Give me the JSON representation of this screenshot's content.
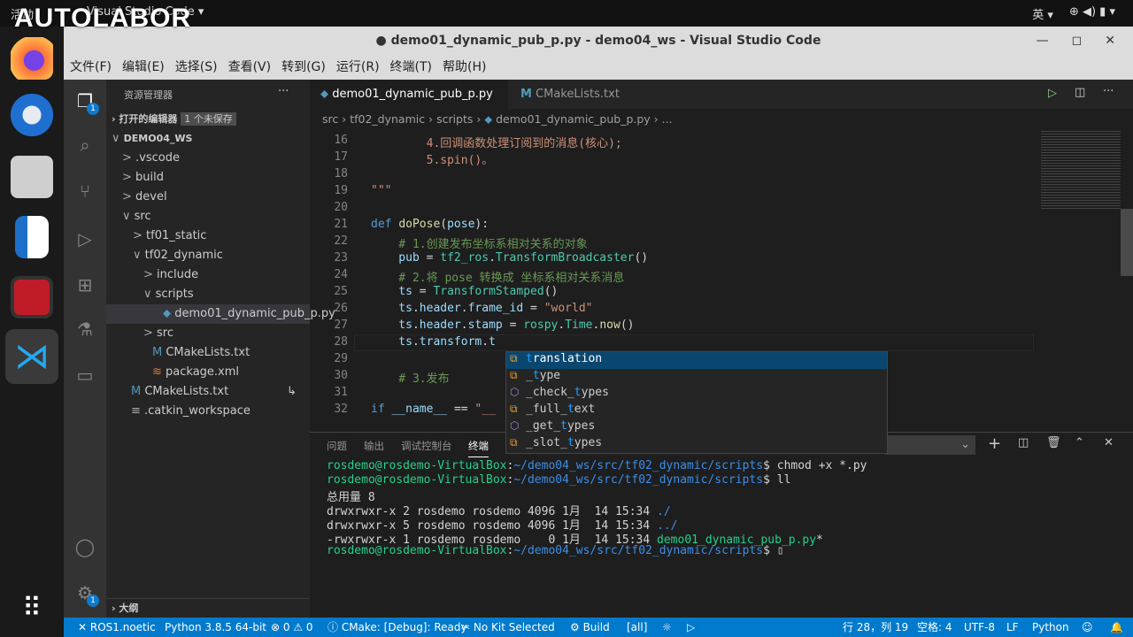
{
  "topbar": {
    "activities": "活动",
    "app": "Visual Studio Code ▾",
    "logo": "AUTOLABOR",
    "ime": "英 ▾",
    "tray": "⊕ ◀) ▮ ▾"
  },
  "window": {
    "title": "● demo01_dynamic_pub_p.py - demo04_ws - Visual Studio Code",
    "controls": [
      "—",
      "◻",
      "✕"
    ]
  },
  "menu": [
    "文件(F)",
    "编辑(E)",
    "选择(S)",
    "查看(V)",
    "转到(G)",
    "运行(R)",
    "终端(T)",
    "帮助(H)"
  ],
  "activity": {
    "explorer_badge": "1",
    "settings_badge": "1"
  },
  "sidebar": {
    "title": "资源管理器",
    "more": "···",
    "open_editors": "打开的编辑器",
    "unsaved": "1 个未保存",
    "outline": "大纲",
    "tree": [
      {
        "label": "DEMO04_WS",
        "indent": 0,
        "arrow": "∨",
        "bold": true
      },
      {
        "label": ".vscode",
        "indent": 1,
        "arrow": ">"
      },
      {
        "label": "build",
        "indent": 1,
        "arrow": ">"
      },
      {
        "label": "devel",
        "indent": 1,
        "arrow": ">"
      },
      {
        "label": "src",
        "indent": 1,
        "arrow": "∨"
      },
      {
        "label": "tf01_static",
        "indent": 2,
        "arrow": ">"
      },
      {
        "label": "tf02_dynamic",
        "indent": 2,
        "arrow": "∨"
      },
      {
        "label": "include",
        "indent": 3,
        "arrow": ">"
      },
      {
        "label": "scripts",
        "indent": 3,
        "arrow": "∨"
      },
      {
        "label": "demo01_dynamic_pub_p.py",
        "indent": 4,
        "icon": "python",
        "selected": true
      },
      {
        "label": "src",
        "indent": 3,
        "arrow": ">"
      },
      {
        "label": "CMakeLists.txt",
        "indent": 3,
        "icon": "cmake"
      },
      {
        "label": "package.xml",
        "indent": 3,
        "icon": "xml"
      },
      {
        "label": "CMakeLists.txt",
        "indent": 1,
        "icon": "cmake",
        "link": "↳"
      },
      {
        "label": ".catkin_workspace",
        "indent": 1,
        "icon": "file"
      }
    ]
  },
  "tabs": [
    {
      "label": "demo01_dynamic_pub_p.py",
      "dirty": "●",
      "active": true
    },
    {
      "label": "CMakeLists.txt",
      "icon": "M"
    }
  ],
  "breadcrumb": [
    "src",
    "tf02_dynamic",
    "scripts",
    "demo01_dynamic_pub_p.py",
    "..."
  ],
  "code": [
    {
      "n": "16",
      "tokens": [
        [
          "        4.回调函数处理订阅到的消息(核心);",
          "y"
        ]
      ]
    },
    {
      "n": "17",
      "tokens": [
        [
          "        5.spin()。",
          "y"
        ]
      ]
    },
    {
      "n": "18",
      "tokens": []
    },
    {
      "n": "19",
      "tokens": [
        [
          "\"\"\"",
          "y"
        ]
      ]
    },
    {
      "n": "20",
      "tokens": []
    },
    {
      "n": "21",
      "tokens": [
        [
          "def ",
          "k"
        ],
        [
          "doPose",
          "f"
        ],
        [
          "(",
          "d"
        ],
        [
          "pose",
          "p"
        ],
        [
          "):",
          "d"
        ]
      ]
    },
    {
      "n": "22",
      "tokens": [
        [
          "    # 1.创建发布坐标系相对关系的对象",
          "c"
        ]
      ]
    },
    {
      "n": "23",
      "tokens": [
        [
          "    pub ",
          "p"
        ],
        [
          "= ",
          "d"
        ],
        [
          "tf2_ros",
          "t"
        ],
        [
          ".",
          "d"
        ],
        [
          "TransformBroadcaster",
          "t"
        ],
        [
          "()",
          "d"
        ]
      ]
    },
    {
      "n": "24",
      "tokens": [
        [
          "    # 2.将 pose 转换成 坐标系相对关系消息",
          "c"
        ]
      ]
    },
    {
      "n": "25",
      "tokens": [
        [
          "    ts ",
          "p"
        ],
        [
          "= ",
          "d"
        ],
        [
          "TransformStamped",
          "t"
        ],
        [
          "()",
          "d"
        ]
      ]
    },
    {
      "n": "26",
      "tokens": [
        [
          "    ts",
          "p"
        ],
        [
          ".",
          "d"
        ],
        [
          "header",
          "p"
        ],
        [
          ".",
          "d"
        ],
        [
          "frame_id ",
          "p"
        ],
        [
          "= ",
          "d"
        ],
        [
          "\"world\"",
          "s"
        ]
      ]
    },
    {
      "n": "27",
      "tokens": [
        [
          "    ts",
          "p"
        ],
        [
          ".",
          "d"
        ],
        [
          "header",
          "p"
        ],
        [
          ".",
          "d"
        ],
        [
          "stamp ",
          "p"
        ],
        [
          "= ",
          "d"
        ],
        [
          "rospy",
          "t"
        ],
        [
          ".",
          "d"
        ],
        [
          "Time",
          "t"
        ],
        [
          ".",
          "d"
        ],
        [
          "now",
          "f"
        ],
        [
          "()",
          "d"
        ]
      ]
    },
    {
      "n": "28",
      "tokens": [
        [
          "    ts",
          "p"
        ],
        [
          ".",
          "d"
        ],
        [
          "transform",
          "p"
        ],
        [
          ".",
          "d"
        ],
        [
          "t",
          "p"
        ]
      ]
    },
    {
      "n": "29",
      "tokens": []
    },
    {
      "n": "30",
      "tokens": [
        [
          "    # 3.发布",
          "c"
        ]
      ]
    },
    {
      "n": "31",
      "tokens": []
    },
    {
      "n": "32",
      "tokens": [
        [
          "if ",
          "k"
        ],
        [
          "__name__ ",
          "p"
        ],
        [
          "== ",
          "d"
        ],
        [
          "\"__",
          "s"
        ]
      ]
    }
  ],
  "suggestions": [
    {
      "pre": "",
      "hl": "t",
      "post": "ranslation",
      "icon": "field"
    },
    {
      "pre": "_",
      "hl": "t",
      "post": "ype",
      "icon": "field"
    },
    {
      "pre": "_check_",
      "hl": "t",
      "post": "ypes",
      "icon": "method"
    },
    {
      "pre": "_full_",
      "hl": "t",
      "post": "ext",
      "icon": "field"
    },
    {
      "pre": "_get_",
      "hl": "t",
      "post": "ypes",
      "icon": "method"
    },
    {
      "pre": "_slot_",
      "hl": "t",
      "post": "ypes",
      "icon": "field"
    }
  ],
  "panel": {
    "tabs": [
      "问题",
      "输出",
      "调试控制台",
      "终端"
    ],
    "active": "终端"
  },
  "terminal": [
    [
      [
        "rosdemo@rosdemo-VirtualBox",
        "g"
      ],
      [
        ":",
        "d"
      ],
      [
        "~/demo04_ws/src/tf02_dynamic/scripts",
        "b"
      ],
      [
        "$ chmod +x *.py",
        "d"
      ]
    ],
    [
      [
        "rosdemo@rosdemo-VirtualBox",
        "g"
      ],
      [
        ":",
        "d"
      ],
      [
        "~/demo04_ws/src/tf02_dynamic/scripts",
        "b"
      ],
      [
        "$ ll",
        "d"
      ]
    ],
    [
      [
        "总用量 8",
        "d"
      ]
    ],
    [
      [
        "drwxrwxr-x 2 rosdemo rosdemo 4096 1月  14 15:34 ",
        "d"
      ],
      [
        "./",
        "b"
      ]
    ],
    [
      [
        "drwxrwxr-x 5 rosdemo rosdemo 4096 1月  14 15:34 ",
        "d"
      ],
      [
        "../",
        "b"
      ]
    ],
    [
      [
        "-rwxrwxr-x 1 rosdemo rosdemo    0 1月  14 15:34 ",
        "d"
      ],
      [
        "demo01_dynamic_pub_p.py",
        "g"
      ],
      [
        "*",
        "d"
      ]
    ],
    [
      [
        "rosdemo@rosdemo-VirtualBox",
        "g"
      ],
      [
        ":",
        "d"
      ],
      [
        "~/demo04_ws/src/tf02_dynamic/scripts",
        "b"
      ],
      [
        "$ ▯",
        "d"
      ]
    ]
  ],
  "status": {
    "remote": "✕ ROS1.noetic",
    "python": "Python 3.8.5 64-bit",
    "problems": "⊗ 0 ⚠ 0",
    "cmake": "ⓘ CMake: [Debug]: Ready",
    "kit": "✂ No Kit Selected",
    "build": "⚙ Build",
    "target": "[all]",
    "pos": "行 28，列 19",
    "spaces": "空格: 4",
    "encoding": "UTF-8",
    "eol": "LF",
    "lang": "Python"
  }
}
